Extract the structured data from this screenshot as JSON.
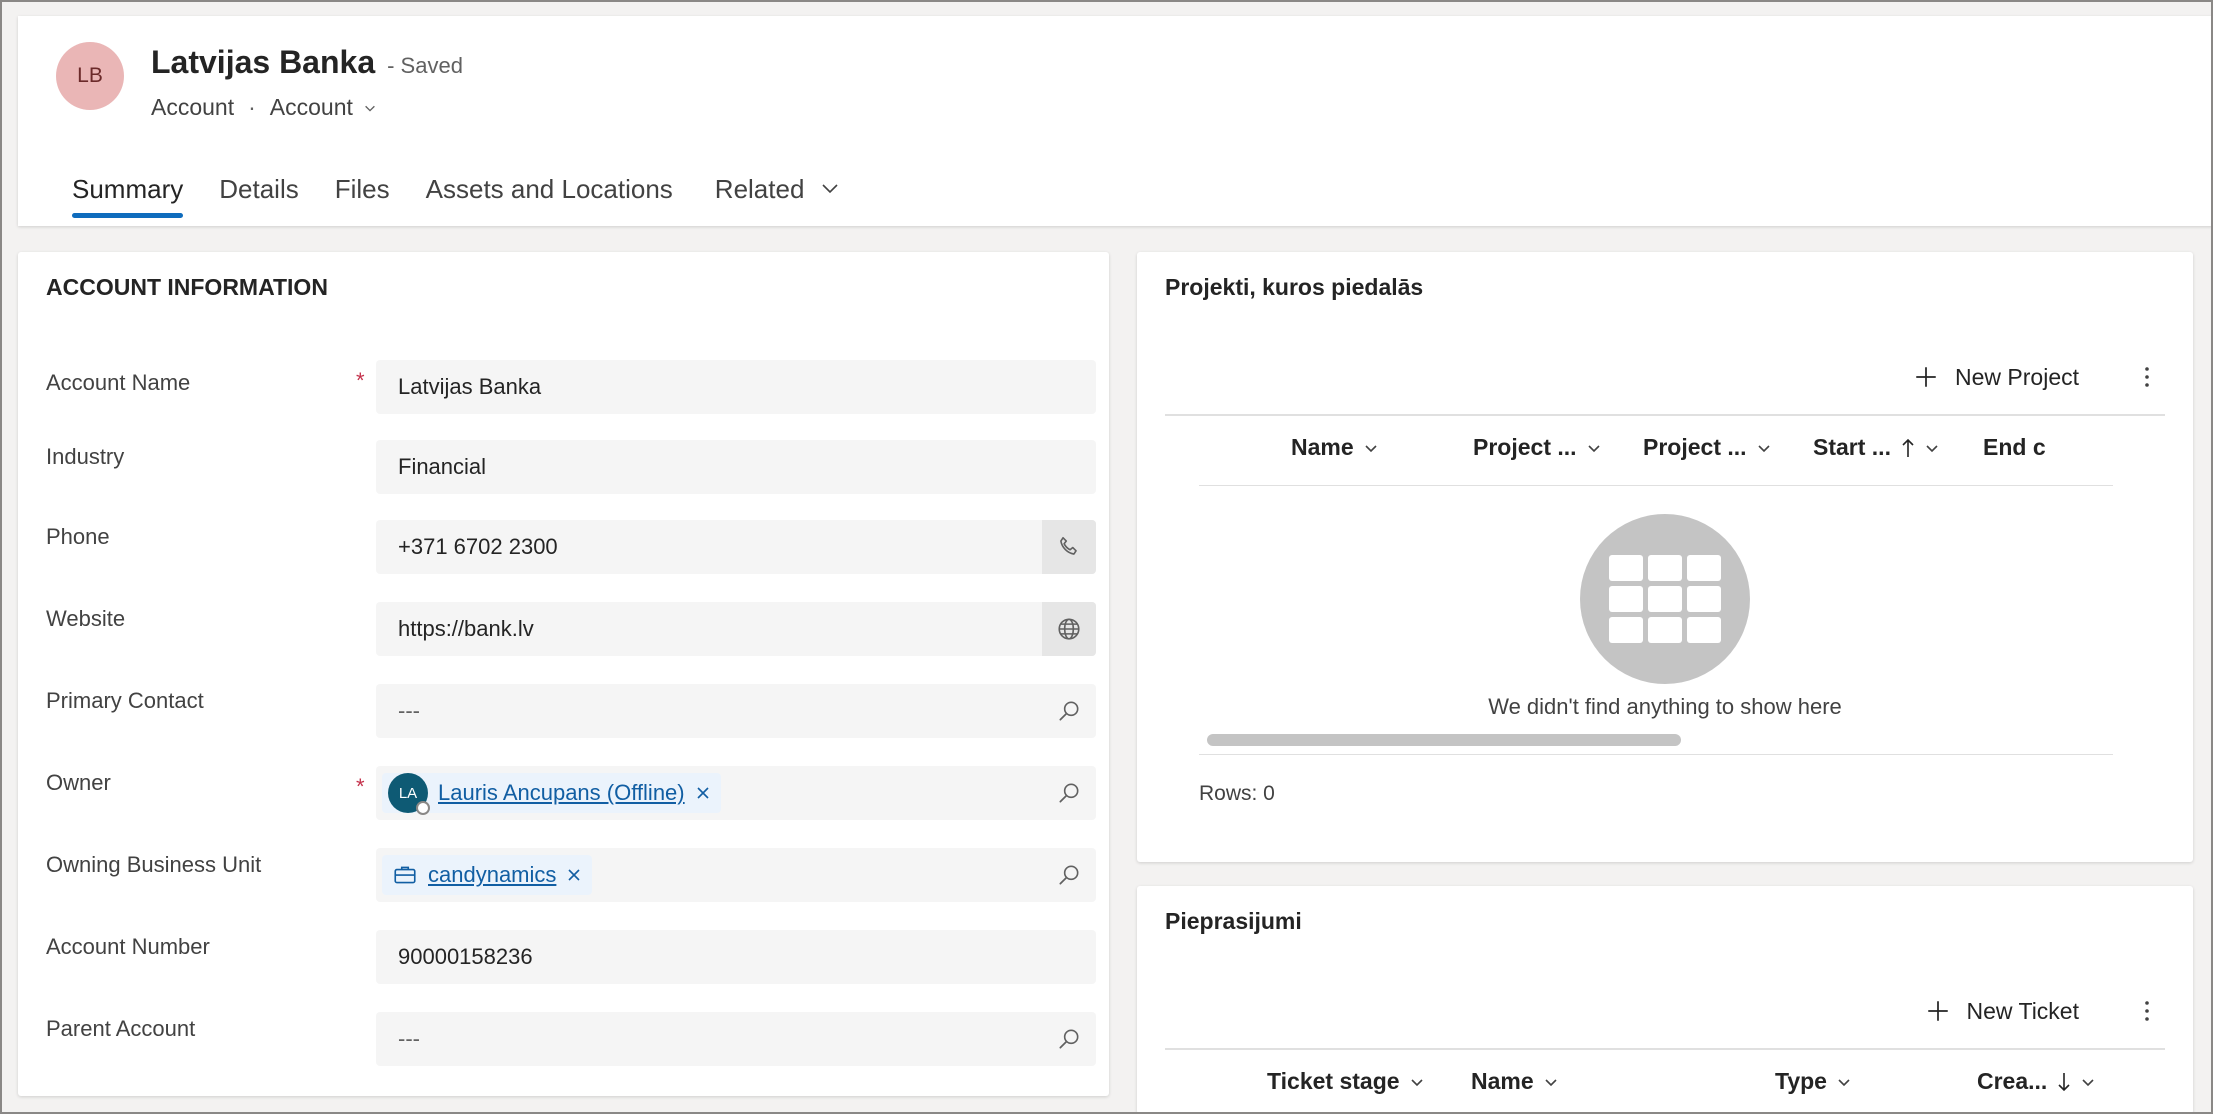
{
  "header": {
    "avatar_initials": "LB",
    "record_name": "Latvijas Banka",
    "save_status": "- Saved",
    "entity": "Account",
    "form_selector": "Account",
    "tabs": [
      {
        "label": "Summary",
        "active": true
      },
      {
        "label": "Details"
      },
      {
        "label": "Files"
      },
      {
        "label": "Assets and Locations"
      },
      {
        "label": "Related"
      }
    ]
  },
  "account_info": {
    "title": "ACCOUNT INFORMATION",
    "fields": {
      "account_name": {
        "label": "Account Name",
        "value": "Latvijas Banka",
        "required": "*"
      },
      "industry": {
        "label": "Industry",
        "value": "Financial"
      },
      "phone": {
        "label": "Phone",
        "value": "+371 6702 2300"
      },
      "website": {
        "label": "Website",
        "value": "https://bank.lv"
      },
      "primary_contact": {
        "label": "Primary Contact",
        "value": "---"
      },
      "owner": {
        "label": "Owner",
        "value": "Lauris Ancupans (Offline)",
        "initials": "LA",
        "required": "*"
      },
      "owning_business_unit": {
        "label": "Owning Business Unit",
        "value": "candynamics"
      },
      "account_number": {
        "label": "Account Number",
        "value": "90000158236"
      },
      "parent_account": {
        "label": "Parent Account",
        "value": "---"
      }
    }
  },
  "projects": {
    "title": "Projekti, kuros piedalās",
    "new_label": "New Project",
    "columns": [
      "Name",
      "Project ...",
      "Project ...",
      "Start ...",
      "End c"
    ],
    "empty_message": "We didn't find anything to show here",
    "rows_label": "Rows: 0"
  },
  "tickets": {
    "title": "Pieprasijumi",
    "new_label": "New Ticket",
    "columns": [
      "Ticket stage",
      "Name",
      "Type",
      "Crea..."
    ]
  },
  "colors": {
    "accent": "#0f6cbd",
    "avatar_bg": "#eab6b6",
    "owner_avatar_bg": "#0e5a74",
    "required": "#c4314b",
    "link": "#115ea3"
  }
}
